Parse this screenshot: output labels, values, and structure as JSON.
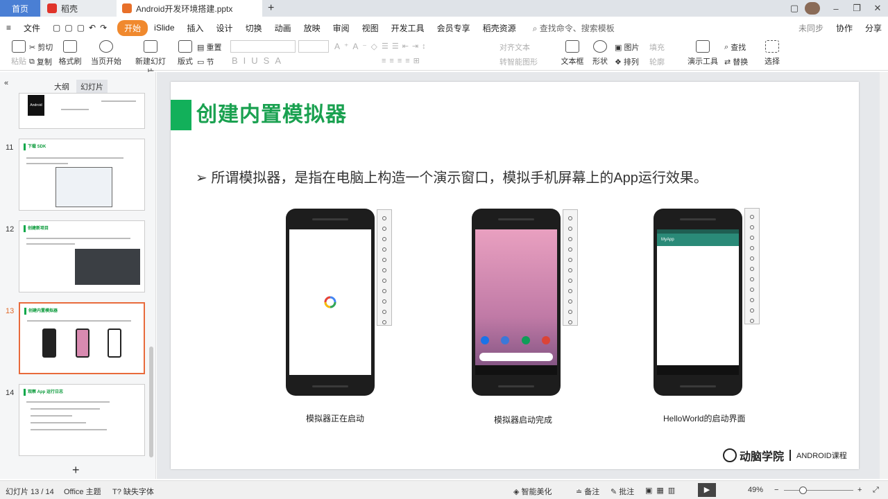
{
  "tabs": {
    "home": "首页",
    "daoke": "稻壳",
    "document": "Android开发环境搭建.pptx"
  },
  "menu": {
    "file": "文件",
    "items": [
      "开始",
      "iSlide",
      "插入",
      "设计",
      "切换",
      "动画",
      "放映",
      "审阅",
      "视图",
      "开发工具",
      "会员专享",
      "稻壳资源"
    ],
    "search": "查找命令、搜索模板",
    "collab": "协作",
    "share": "分享",
    "sync": "未同步"
  },
  "ribbon": {
    "cut": "剪切",
    "copy": "复制",
    "paste": "粘贴",
    "format_painter": "格式刷",
    "from_current": "当页开始",
    "new_slide": "新建幻灯片",
    "layout": "版式",
    "reset": "重置",
    "section": "节",
    "text_box": "文本框",
    "shapes": "形状",
    "picture": "图片",
    "arrange": "排列",
    "fill": "填充",
    "outline": "轮廓",
    "present_tools": "演示工具",
    "find": "查找",
    "replace": "替换",
    "select": "选择",
    "align_text": "对齐文本",
    "smartart": "转智能图形"
  },
  "leftpanel": {
    "outline_tab": "大纲",
    "slides_tab": "幻灯片",
    "add": "+",
    "thumbs": [
      {
        "num": "",
        "title": "Android"
      },
      {
        "num": "11",
        "title": "下载 SDK"
      },
      {
        "num": "12",
        "title": "创建新项目"
      },
      {
        "num": "13",
        "title": "创建内置模拟器"
      },
      {
        "num": "14",
        "title": "观察 App 运行日志"
      }
    ]
  },
  "slide": {
    "title": "创建内置模拟器",
    "bullet": "所谓模拟器，是指在电脑上构造一个演示窗口，模拟手机屏幕上的App运行效果。",
    "captions": [
      "模拟器正在启动",
      "模拟器启动完成",
      "HelloWorld的启动界面"
    ],
    "app_title": "MyApp",
    "logo_text": "动脑学院",
    "course": "ANDROID课程"
  },
  "status": {
    "slide_counter": "幻灯片 13 / 14",
    "theme": "Office 主题",
    "missing_font": "缺失字体",
    "beautify": "智能美化",
    "notes": "备注",
    "comments": "批注",
    "zoom": "49%"
  },
  "colors": {
    "accent": "#f0892e",
    "title_green": "#1aa150",
    "bar_green": "#12b05a"
  }
}
